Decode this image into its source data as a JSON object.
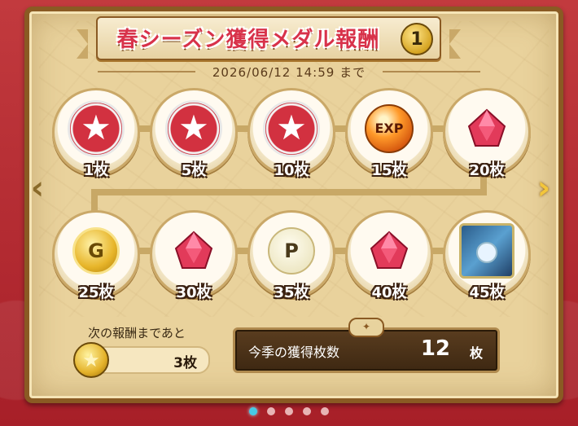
{
  "header": {
    "title": "春シーズン獲得メダル報酬",
    "page_number": "1",
    "deadline": "2026/06/12 14:59 まで"
  },
  "rewards": [
    {
      "count_label": "1枚",
      "item": "medal"
    },
    {
      "count_label": "5枚",
      "item": "medal"
    },
    {
      "count_label": "10枚",
      "item": "medal"
    },
    {
      "count_label": "15枚",
      "item": "exp-orb",
      "text": "EXP"
    },
    {
      "count_label": "20枚",
      "item": "gem"
    },
    {
      "count_label": "25枚",
      "item": "gold-coin",
      "text": "G"
    },
    {
      "count_label": "30枚",
      "item": "gem"
    },
    {
      "count_label": "35枚",
      "item": "point-coin",
      "text": "P"
    },
    {
      "count_label": "40枚",
      "item": "gem"
    },
    {
      "count_label": "45枚",
      "item": "treasure-chest"
    }
  ],
  "next_reward": {
    "label": "次の報酬まであと",
    "remaining": "3枚"
  },
  "total": {
    "label": "今季の獲得枚数",
    "value": "12",
    "unit": "枚"
  },
  "pagination": {
    "pages": 5,
    "active": 0
  }
}
